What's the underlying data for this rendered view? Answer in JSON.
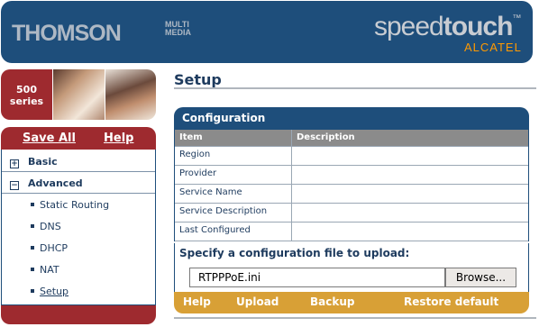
{
  "header": {
    "brand": "THOMSON",
    "brand_sub": "MULTI MEDIA",
    "product_left": "speed",
    "product_right": "touch",
    "trademark": "™",
    "alcatel": "ALCATEL"
  },
  "banner": {
    "series_number": "500",
    "series_label": "series"
  },
  "nav": {
    "save_all": "Save All",
    "help": "Help",
    "groups": [
      {
        "label": "Basic",
        "toggle": "+"
      },
      {
        "label": "Advanced",
        "toggle": "−"
      }
    ],
    "items": [
      {
        "label": "Static Routing"
      },
      {
        "label": "DNS"
      },
      {
        "label": "DHCP"
      },
      {
        "label": "NAT"
      },
      {
        "label": "Setup"
      }
    ]
  },
  "main": {
    "title": "Setup",
    "section_title": "Configuration",
    "columns": [
      "Item",
      "Description"
    ],
    "rows": [
      {
        "item": "Region",
        "description": ""
      },
      {
        "item": "Provider",
        "description": ""
      },
      {
        "item": "Service Name",
        "description": ""
      },
      {
        "item": "Service Description",
        "description": ""
      },
      {
        "item": "Last Configured",
        "description": ""
      }
    ],
    "upload_label": "Specify a configuration file to upload:",
    "file_value": "RTPPPoE.ini",
    "browse_label": "Browse...",
    "actions": [
      "Help",
      "Upload",
      "Backup",
      "Restore default"
    ]
  },
  "colors": {
    "header_blue": "#1e4e7b",
    "nav_red": "#9e2a2f",
    "action_gold": "#d8a036",
    "alcatel_orange": "#ff9900"
  }
}
